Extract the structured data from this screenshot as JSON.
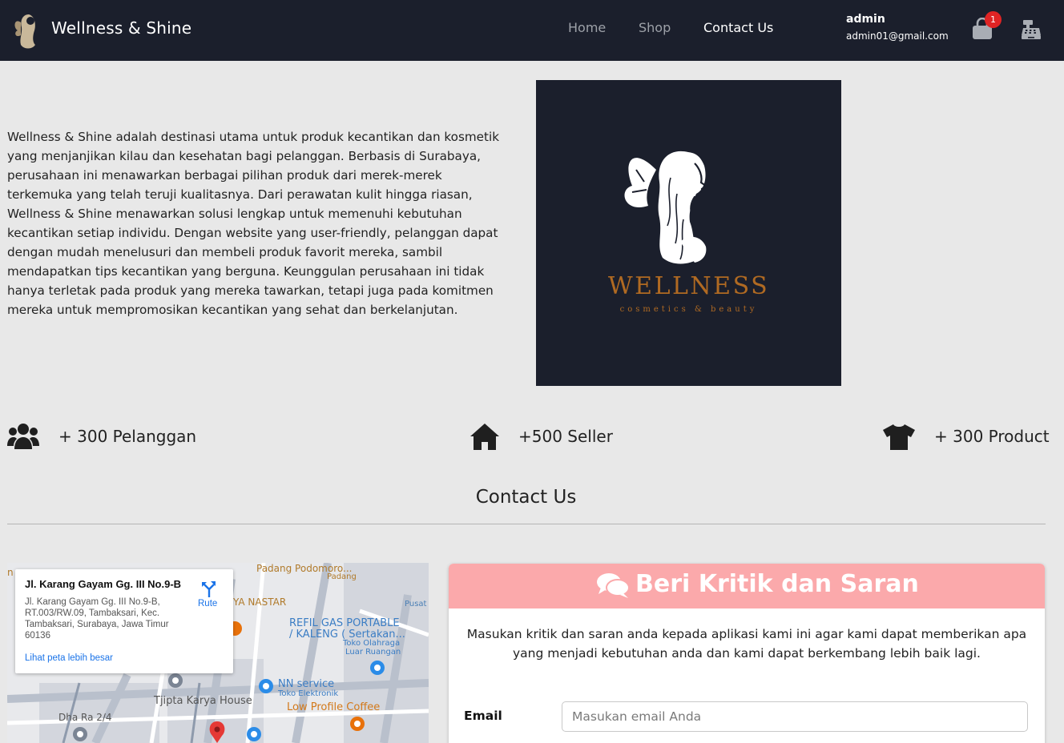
{
  "navbar": {
    "brand": "Wellness & Shine",
    "links": {
      "home": "Home",
      "shop": "Shop",
      "contact": "Contact Us"
    },
    "user": {
      "name": "admin",
      "email": "admin01@gmail.com"
    },
    "cart_count": "1",
    "icons": [
      "logo-fairy-icon",
      "shopping-bag-icon",
      "cash-register-icon"
    ]
  },
  "about": {
    "text": "Wellness & Shine adalah destinasi utama untuk produk kecantikan dan kosmetik yang menjanjikan kilau dan kesehatan bagi pelanggan. Berbasis di Surabaya, perusahaan ini menawarkan berbagai pilihan produk dari merek-merek terkemuka yang telah teruji kualitasnya. Dari perawatan kulit hingga riasan, Wellness & Shine menawarkan solusi lengkap untuk memenuhi kebutuhan kecantikan setiap individu. Dengan website yang user-friendly, pelanggan dapat dengan mudah menelusuri dan membeli produk favorit mereka, sambil mendapatkan tips kecantikan yang berguna. Keunggulan perusahaan ini tidak hanya terletak pada produk yang mereka tawarkan, tetapi juga pada komitmen mereka untuk mempromosikan kecantikan yang sehat dan berkelanjutan.",
    "logo_word": "WELLNESS",
    "logo_tagline": "cosmetics & beauty"
  },
  "stats": [
    {
      "label": "+ 300 Pelanggan",
      "icon": "users-icon"
    },
    {
      "label": "+500 Seller",
      "icon": "home-icon"
    },
    {
      "label": "+ 300 Product",
      "icon": "tshirt-icon"
    }
  ],
  "contact": {
    "heading": "Contact Us"
  },
  "map": {
    "card_title": "Jl. Karang Gayam Gg. III No.9-B",
    "card_address": "Jl. Karang Gayam Gg. III No.9-B, RT.003/RW.09, Tambaksari, Kec. Tambaksari, Surabaya, Jawa Timur 60136",
    "route_label": "Rute",
    "larger_map_link": "Lihat peta lebih besar",
    "labels": {
      "padang": "Padang Podomoro...",
      "padang_sub": "Padang",
      "nastar": "YA NASTAR",
      "pusat": "Pusat",
      "refil": "REFIL GAS PORTABLE",
      "kaleng": "/ KALENG ( Sertakan...",
      "toko_olahraga": "Toko Olahraga",
      "luar_ruangan": "Luar Ruangan",
      "nn_service": "NN service",
      "toko_elektronik": "Toko Elektronik",
      "tjipta": "Tjipta Karya House",
      "low_profile": "Low Profile Coffee",
      "dharma": "Dha Ra 2/4",
      "edge": "n"
    }
  },
  "feedback": {
    "title": "Beri Kritik dan Saran",
    "description": "Masukan kritik dan saran anda kepada aplikasi kami ini agar kami dapat memberikan apa yang menjadi kebutuhan anda dan kami dapat berkembang lebih baik lagi.",
    "email_label": "Email",
    "email_placeholder": "Masukan email Anda",
    "email_value": ""
  },
  "colors": {
    "navbar": "#1b1f2c",
    "background": "#e8e8e8",
    "feedback_header": "#fba9ab",
    "badge": "#e02424",
    "logo_gold": "#b06a22",
    "link_blue": "#1a73e8"
  }
}
